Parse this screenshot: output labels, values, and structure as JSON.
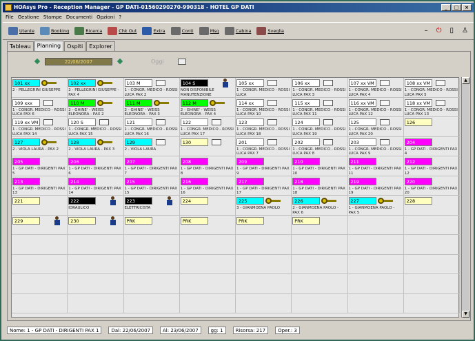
{
  "window": {
    "title": "HOAsys Pro  - Reception Manager - GP DATI-01560290270-990318 - HOTEL GP DATI"
  },
  "menu": [
    "File",
    "Gestione",
    "Stampe",
    "Documenti",
    "Opzioni",
    "?"
  ],
  "toolbar": [
    {
      "label": "Utente",
      "icon": "users-icon",
      "color": "#4a6ea8"
    },
    {
      "label": "Booking",
      "icon": "booking-icon",
      "color": "#5a8ab8"
    },
    {
      "label": "Ricerca",
      "icon": "search-icon",
      "color": "#4a7a4a"
    },
    {
      "label": "Chk Out",
      "icon": "checkout-icon",
      "color": "#b84a4a"
    },
    {
      "label": "Extra",
      "icon": "extra-icon",
      "color": "#2a5aa8"
    },
    {
      "label": "Conti",
      "icon": "accounts-icon",
      "color": "#6a6a6a"
    },
    {
      "label": "Msg",
      "icon": "message-icon",
      "color": "#6a6a6a"
    },
    {
      "label": "Cabina",
      "icon": "phone-icon",
      "color": "#6a6a6a"
    },
    {
      "label": "Sveglia",
      "icon": "alarm-icon",
      "color": "#8a4a4a"
    }
  ],
  "tabs": [
    "Tableau",
    "Planning",
    "Ospiti",
    "Explorer"
  ],
  "active_tab": "Planning",
  "date": "22/06/2007",
  "today_label": "Oggi",
  "rooms": [
    {
      "num": "101 xx",
      "bg": "#00ffff",
      "guest": "2 - PELLEGRINI GIUSEPPE",
      "icon": "key"
    },
    {
      "num": "102 xx",
      "bg": "#00ffff",
      "guest": "2 - PELLEGRINI GIUSEPPE - PAX 4",
      "icon": "key"
    },
    {
      "num": "103 M",
      "bg": "#ffffff",
      "guest": "1 - CONGR. MEDICO - ROSSI LUCA PAX 2",
      "icon": "bed"
    },
    {
      "num": "104 S",
      "bg": "#000000",
      "fg": "#ffffff",
      "guest": "NON DISPONIBILE MANUTENZIONE",
      "icon": "person"
    },
    {
      "num": "105 xx",
      "bg": "#ffffff",
      "guest": "1 - CONGR. MEDICO - ROSSI LUCA",
      "icon": "bed"
    },
    {
      "num": "106 xx",
      "bg": "#ffffff",
      "guest": "1 - CONGR. MEDICO - ROSSI LUCA PAX 3",
      "icon": "bed"
    },
    {
      "num": "107 xx VM",
      "bg": "#ffffff",
      "guest": "1 - CONGR. MEDICO - ROSSI LUCA PAX 4",
      "icon": "bed"
    },
    {
      "num": "108 xx VM",
      "bg": "#ffffff",
      "guest": "1 - CONGR. MEDICO - ROSSI LUCA PAX 5",
      "icon": "bed"
    },
    {
      "num": "109 xxx",
      "bg": "#ffffff",
      "guest": "1 - CONGR. MEDICO - ROSSI LUCA PAX 6",
      "icon": "bed"
    },
    {
      "num": "110 M",
      "bg": "#00ff00",
      "guest": "2 - GHINE' - WEISS ELEONORA - PAX 2",
      "icon": "key"
    },
    {
      "num": "111 M",
      "bg": "#00ff00",
      "guest": "2 - GHINE' - WEISS ELEONORA - PAX 3",
      "icon": "key"
    },
    {
      "num": "112 M",
      "bg": "#00ff00",
      "guest": "2 - GHINE' - WEISS ELEONORA - PAX 4",
      "icon": "key"
    },
    {
      "num": "114 xx",
      "bg": "#ffffff",
      "guest": "1 - CONGR. MEDICO - ROSSI LUCA PAX 10",
      "icon": "bed"
    },
    {
      "num": "115 xx",
      "bg": "#ffffff",
      "guest": "1 - CONGR. MEDICO - ROSSI LUCA PAX 11",
      "icon": "bed"
    },
    {
      "num": "116 xx VM",
      "bg": "#ffffff",
      "guest": "1 - CONGR. MEDICO - ROSSI LUCA PAX 12",
      "icon": "bed"
    },
    {
      "num": "118 xx VM",
      "bg": "#ffffff",
      "guest": "1 - CONGR. MEDICO - ROSSI LUCA PAX 13",
      "icon": "bed"
    },
    {
      "num": "119 xx VM",
      "bg": "#ffffff",
      "guest": "1 - CONGR. MEDICO - ROSSI LUCA PAX 14",
      "icon": "bed"
    },
    {
      "num": "120 S",
      "bg": "#ffffff",
      "guest": "1 - CONGR. MEDICO - ROSSI LUCA PAX 15",
      "icon": "bed"
    },
    {
      "num": "121",
      "bg": "#ffffff",
      "guest": "1 - CONGR. MEDICO - ROSSI LUCA PAX 16",
      "icon": "bed"
    },
    {
      "num": "122",
      "bg": "#ffffff",
      "guest": "1 - CONGR. MEDICO - ROSSI LUCA PAX 17",
      "icon": "bed"
    },
    {
      "num": "123",
      "bg": "#ffffff",
      "guest": "1 - CONGR. MEDICO - ROSSI LUCA PAX 18",
      "icon": "bed"
    },
    {
      "num": "124",
      "bg": "#ffffff",
      "guest": "1 - CONGR. MEDICO - ROSSI LUCA PAX 19",
      "icon": "bed"
    },
    {
      "num": "125",
      "bg": "#ffffff",
      "guest": "1 - CONGR. MEDICO - ROSSI LUCA PAX 20",
      "icon": "bed"
    },
    {
      "num": "126",
      "bg": "#ffffc0",
      "guest": "",
      "icon": "none"
    },
    {
      "num": "127",
      "bg": "#00ffff",
      "guest": "2 - VIOLA LAURA - PAX 2",
      "icon": "key"
    },
    {
      "num": "128",
      "bg": "#00ffff",
      "guest": "2 - VIOLA LAURA - PAX 3",
      "icon": "key"
    },
    {
      "num": "129",
      "bg": "#00ffff",
      "guest": "2 - VIOLA LAURA",
      "icon": "bed"
    },
    {
      "num": "130",
      "bg": "#ffffc0",
      "guest": "",
      "icon": "bed"
    },
    {
      "num": "201",
      "bg": "#ffffff",
      "guest": "1 - CONGR. MEDICO - ROSSI LUCA PAX 7",
      "icon": "bed"
    },
    {
      "num": "202",
      "bg": "#ffffff",
      "guest": "1 - CONGR. MEDICO - ROSSI LUCA PAX 8",
      "icon": "bed"
    },
    {
      "num": "203",
      "bg": "#ffffff",
      "guest": "1 - CONGR. MEDICO - ROSSI LUCA PAX 9",
      "icon": "bed"
    },
    {
      "num": "204",
      "bg": "#ff00ff",
      "fg": "#ffffff",
      "guest": "1 - GP DATI - DIRIGENTI PAX 4",
      "icon": "none"
    },
    {
      "num": "205",
      "bg": "#ff00ff",
      "fg": "#ffffff",
      "guest": "1 - GP DATI - DIRIGENTI PAX 5",
      "icon": "none"
    },
    {
      "num": "206",
      "bg": "#ff00ff",
      "fg": "#ffffff",
      "guest": "1 - GP DATI - DIRIGENTI PAX 6",
      "icon": "none"
    },
    {
      "num": "207",
      "bg": "#ff00ff",
      "fg": "#ffffff",
      "guest": "1 - GP DATI - DIRIGENTI PAX 7",
      "icon": "none"
    },
    {
      "num": "208",
      "bg": "#ff00ff",
      "fg": "#ffffff",
      "guest": "1 - GP DATI - DIRIGENTI PAX 8",
      "icon": "none"
    },
    {
      "num": "209",
      "bg": "#ff00ff",
      "fg": "#ffffff",
      "guest": "1 - GP DATI - DIRIGENTI PAX 9",
      "icon": "none"
    },
    {
      "num": "210",
      "bg": "#ff00ff",
      "fg": "#ffffff",
      "guest": "1 - GP DATI - DIRIGENTI PAX 10",
      "icon": "none"
    },
    {
      "num": "211",
      "bg": "#ff00ff",
      "fg": "#ffffff",
      "guest": "1 - GP DATI - DIRIGENTI PAX 11",
      "icon": "none"
    },
    {
      "num": "212",
      "bg": "#ff00ff",
      "fg": "#ffffff",
      "guest": "1 - GP DATI - DIRIGENTI PAX 12",
      "icon": "none"
    },
    {
      "num": "213",
      "bg": "#ff00ff",
      "fg": "#ffffff",
      "guest": "1 - GP DATI - DIRIGENTI PAX 13",
      "icon": "none"
    },
    {
      "num": "214",
      "bg": "#ff00ff",
      "fg": "#ffffff",
      "guest": "1 - GP DATI - DIRIGENTI PAX 14",
      "icon": "none"
    },
    {
      "num": "215",
      "bg": "#ff00ff",
      "fg": "#ffffff",
      "guest": "1 - GP DATI - DIRIGENTI PAX 15",
      "icon": "none"
    },
    {
      "num": "216",
      "bg": "#ff00ff",
      "fg": "#ffffff",
      "guest": "1 - GP DATI - DIRIGENTI PAX 16",
      "icon": "none"
    },
    {
      "num": "217",
      "bg": "#ff00ff",
      "fg": "#ffffff",
      "guest": "1 - GP DATI - DIRIGENTI PAX 17",
      "icon": "none"
    },
    {
      "num": "218",
      "bg": "#ff00ff",
      "fg": "#ffffff",
      "guest": "1 - GP DATI - DIRIGENTI PAX 18",
      "icon": "none"
    },
    {
      "num": "219",
      "bg": "#ff00ff",
      "fg": "#ffffff",
      "guest": "1 - GP DATI - DIRIGENTI PAX 19",
      "icon": "none"
    },
    {
      "num": "220",
      "bg": "#ff00ff",
      "fg": "#ffffff",
      "guest": "1 - GP DATI - DIRIGENTI PAX 20",
      "icon": "none"
    },
    {
      "num": "221",
      "bg": "#ffffc0",
      "guest": "",
      "icon": "none"
    },
    {
      "num": "222",
      "bg": "#000000",
      "fg": "#ffffff",
      "guest": "IDRAULICO",
      "icon": "person"
    },
    {
      "num": "223",
      "bg": "#000000",
      "fg": "#ffffff",
      "guest": "ELETTRICISTA",
      "icon": "person"
    },
    {
      "num": "224",
      "bg": "#ffffc0",
      "guest": "",
      "icon": "none"
    },
    {
      "num": "225",
      "bg": "#00ffff",
      "guest": "3 - GIANMOENA PAOLO",
      "icon": "key"
    },
    {
      "num": "226",
      "bg": "#00ffff",
      "guest": "2 - GIANMOENA PAOLO - PAX 6",
      "icon": "key"
    },
    {
      "num": "227",
      "bg": "#00ffff",
      "guest": "1 - GIANMOENA PAOLO - PAX 5",
      "icon": "key"
    },
    {
      "num": "228",
      "bg": "#ffffc0",
      "guest": "",
      "icon": "none"
    },
    {
      "num": "229",
      "bg": "#ffffc0",
      "guest": "",
      "icon": "person"
    },
    {
      "num": "230",
      "bg": "#ffffc0",
      "guest": "",
      "icon": "person"
    },
    {
      "num": "PRK",
      "bg": "#ffffc0",
      "guest": "",
      "icon": "none"
    },
    {
      "num": "PRK",
      "bg": "#ffffc0",
      "guest": "",
      "icon": "none"
    },
    {
      "num": "PRK",
      "bg": "#ffffc0",
      "guest": "",
      "icon": "none"
    },
    {
      "num": "PRK",
      "bg": "#ffffc0",
      "guest": "",
      "icon": "none"
    }
  ],
  "status": {
    "nome": "Nome: 1 - GP DATI - DIRIGENTI  PAX 1",
    "dal": "Dal: 22/06/2007",
    "al": "Al: 23/06/2007",
    "gg": "gg: 1",
    "risorsa": "Risorsa: 217",
    "oper": "Oper.: 3"
  }
}
